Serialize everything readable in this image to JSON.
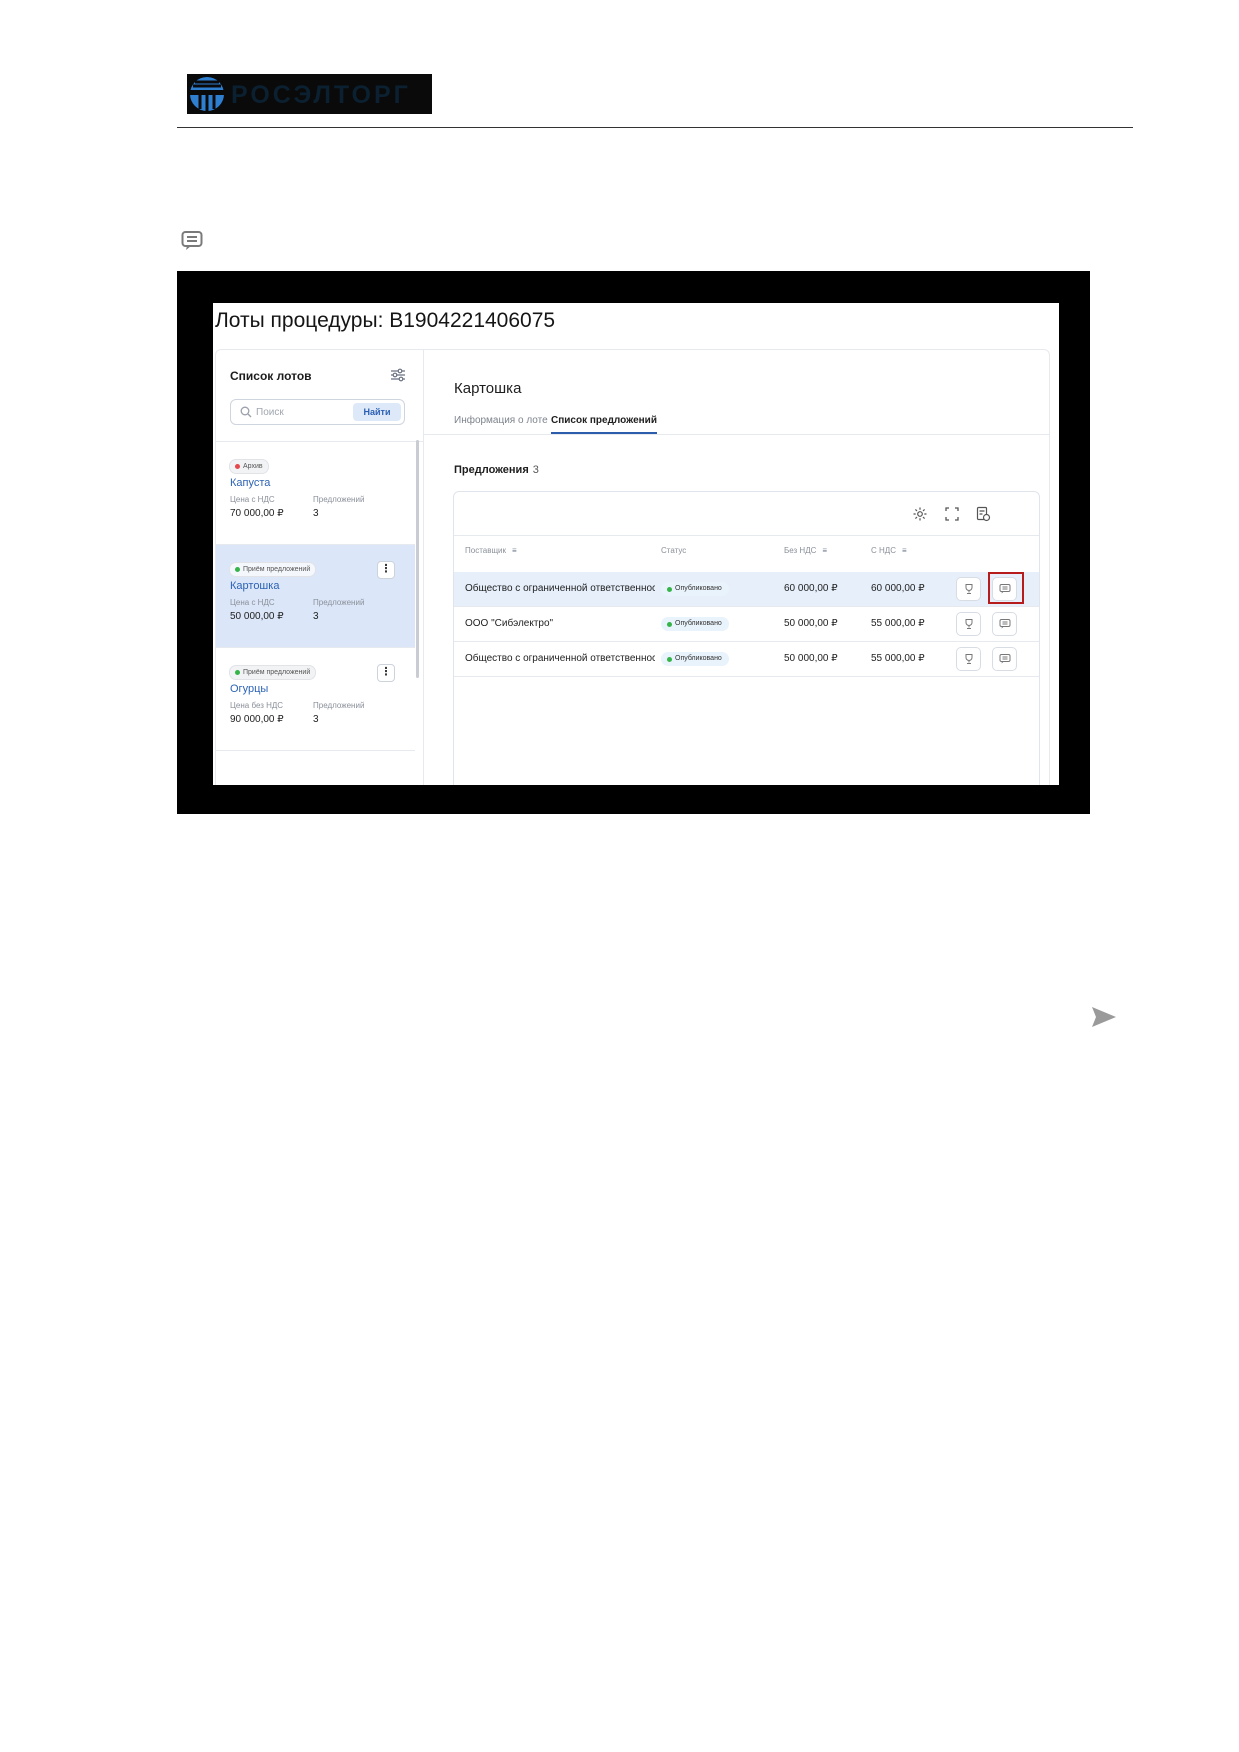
{
  "header": {
    "logo_text": "РОСЭЛТОРГ"
  },
  "screenshot": {
    "procedure_title": "Лоты процедуры: В1904221406075",
    "sidebar": {
      "title": "Список лотов",
      "search_placeholder": "Поиск",
      "find_label": "Найти",
      "lots": [
        {
          "status": "Архив",
          "status_color": "#e5484d",
          "name": "Капуста",
          "price_label": "Цена с НДС",
          "offers_label": "Предложений",
          "price": "70 000,00 ₽",
          "offers": "3"
        },
        {
          "status": "Приём предложений",
          "status_color": "#35b44a",
          "name": "Картошка",
          "price_label": "Цена с НДС",
          "offers_label": "Предложений",
          "price": "50 000,00 ₽",
          "offers": "3"
        },
        {
          "status": "Приём предложений",
          "status_color": "#35b44a",
          "name": "Огурцы",
          "price_label": "Цена без НДС",
          "offers_label": "Предложений",
          "price": "90 000,00 ₽",
          "offers": "3"
        }
      ]
    },
    "content": {
      "lot_title": "Картошка",
      "tabs": [
        "Информация о лоте",
        "Список предложений"
      ],
      "active_tab": "Список предложений",
      "offers_title": "Предложения",
      "offers_count": "3",
      "table": {
        "headers": [
          "Поставщик",
          "Статус",
          "Без НДС",
          "С НДС"
        ],
        "rows": [
          {
            "supplier": "Общество с ограниченной ответственностью",
            "status": "Опубликовано",
            "no_vat": "60 000,00 ₽",
            "with_vat": "60 000,00 ₽"
          },
          {
            "supplier": "ООО \"Сибэлектро\"",
            "status": "Опубликовано",
            "no_vat": "50 000,00 ₽",
            "with_vat": "55 000,00 ₽"
          },
          {
            "supplier": "Общество с ограниченной ответственностью",
            "status": "Опубликовано",
            "no_vat": "50 000,00 ₽",
            "with_vat": "55 000,00 ₽"
          }
        ]
      }
    }
  },
  "icons": [
    "logo-icon",
    "comment-icon",
    "filter-icon",
    "search-icon",
    "gear-icon",
    "fullscreen-icon",
    "export-icon",
    "trophy-icon",
    "send-icon"
  ],
  "colors": {
    "accent": "#2d63b5",
    "highlight": "#b71c1c",
    "active_row": "#dbe6f8"
  }
}
